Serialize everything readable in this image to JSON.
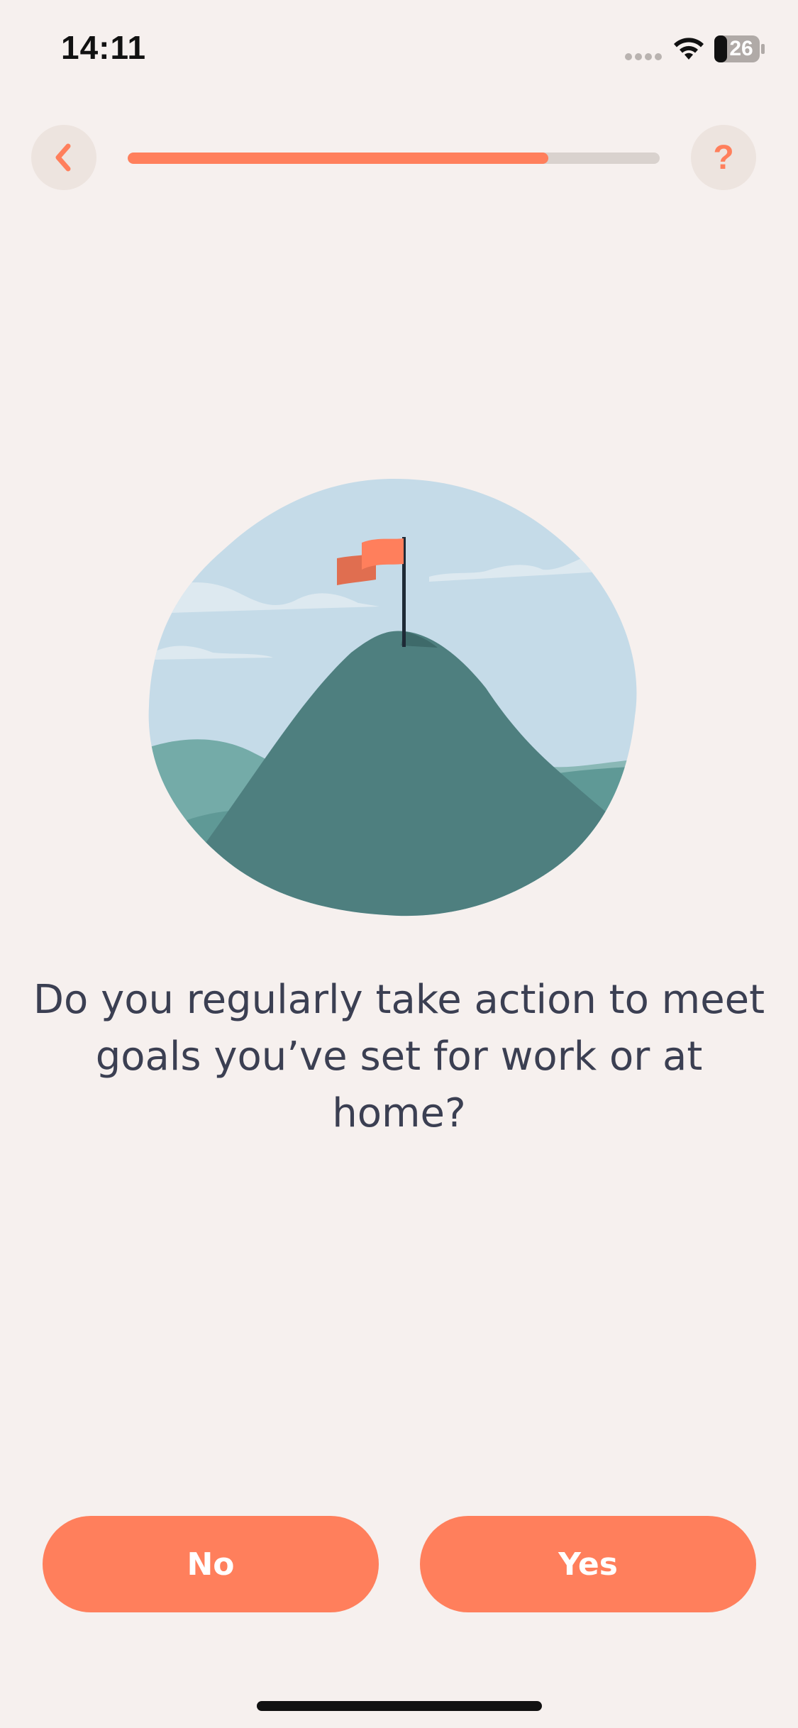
{
  "status_bar": {
    "time": "14:11",
    "battery_level": "26",
    "icons": [
      "cellular-signal-icon",
      "wifi-icon",
      "battery-icon"
    ]
  },
  "nav": {
    "back_icon": "chevron-left-icon",
    "help_label": "?",
    "progress_fraction": 0.79
  },
  "illustration": {
    "name": "mountain-flag-illustration"
  },
  "question": {
    "text": "Do you regularly take action to meet goals you’ve set for work or at home?"
  },
  "answers": {
    "no_label": "No",
    "yes_label": "Yes"
  },
  "colors": {
    "accent": "#ff7f5c",
    "background": "#f6f0ee",
    "text": "#3b3f52",
    "sky": "#c5dbe8",
    "mountain": "#4e7f7f"
  }
}
